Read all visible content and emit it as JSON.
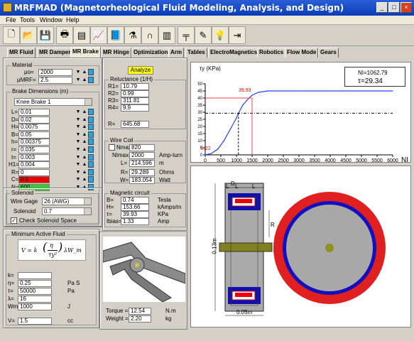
{
  "window": {
    "title": "MRFMAD (Magnetorheological Fluid Modeling, Analysis, and Design)",
    "min": "_",
    "max": "□",
    "close": "×"
  },
  "menu": [
    "File",
    "Tools",
    "Window",
    "Help"
  ],
  "toolbar_icons": [
    "new-icon",
    "open-icon",
    "save-icon",
    "print-icon",
    "database-icon",
    "chart-icon",
    "book-icon",
    "flask-icon",
    "magnet-icon",
    "cylinder-icon",
    "crane-icon",
    "edit-icon",
    "bulb-icon",
    "exit-icon"
  ],
  "tabs": [
    "MR Fluid",
    "MR Damper",
    "MR Brake",
    "MR Hinge",
    "Optimization",
    "Arm",
    "Tables",
    "ElectroMagnetics",
    "Robotics",
    "Flow Mode",
    "Gears"
  ],
  "material": {
    "title": "Material",
    "mu_label": "μo=",
    "mu": "2000",
    "murp_label": "μMRF=",
    "murp": "2.5"
  },
  "brake_dims": {
    "title": "Brake Dimensions (m)",
    "select": "Knee Brake 1",
    "rows": [
      {
        "label": "L=",
        "value": "0.01"
      },
      {
        "label": "D=",
        "value": "0.02"
      },
      {
        "label": "H=",
        "value": "0.0075"
      },
      {
        "label": "B=",
        "value": "0.05"
      },
      {
        "label": "h=",
        "value": "0.00375"
      },
      {
        "label": "r=",
        "value": "0.035"
      },
      {
        "label": "t=",
        "value": "0.003"
      },
      {
        "label": "H1=",
        "value": "0.004"
      },
      {
        "label": "R=",
        "value": "0"
      },
      {
        "label": "C=",
        "value": "0.0"
      },
      {
        "label": "N=",
        "value": "600"
      }
    ]
  },
  "reluctance": {
    "title": "Reluctance (1/H)",
    "rows": [
      {
        "label": "R1=",
        "value": "10.79"
      },
      {
        "label": "R2=",
        "value": "0.99"
      },
      {
        "label": "R3=",
        "value": "311.81"
      },
      {
        "label": "R4=",
        "value": "9.9"
      }
    ],
    "total_label": "R=",
    "total": "645.68"
  },
  "analyze": "Analyze",
  "wire_coil": {
    "title": "Wire Coil",
    "nmax_label": "Nmax=",
    "nmax": "820",
    "nimax_label": "NImax=",
    "nimax": "2000",
    "nimax_unit": "Amp-turn",
    "l_label": "L=",
    "l": "214.596",
    "l_unit": "m",
    "r_label": "R=",
    "r": "29.289",
    "r_unit": "Ohms",
    "w_label": "W=",
    "w": "183.054",
    "w_unit": "Watt"
  },
  "mag_circuit": {
    "title": "Magnetic circuit",
    "rows": [
      {
        "label": "B=",
        "value": "0.74",
        "unit": "Tesla"
      },
      {
        "label": "H=",
        "value": "153.66",
        "unit": "kAmps/m"
      },
      {
        "label": "τ=",
        "value": "39.93",
        "unit": "KPa"
      },
      {
        "label": "Ibias=",
        "value": "1.33",
        "unit": "Amp"
      }
    ]
  },
  "solenoid": {
    "title": "Solenoid",
    "wire_label": "Wire Gage",
    "wire": "26 (AWG)",
    "sol_label": "Solenoid",
    "sol": "0.7",
    "check_label": "Check Solenoid Space",
    "check": "✓"
  },
  "min_fluid": {
    "title": "Minimum Active Fluid",
    "formula_v": "V = k",
    "formula_frac_top": "η",
    "formula_frac_bot": "τy²",
    "formula_tail": "λW_m",
    "rows": [
      {
        "label": "k=",
        "value": "",
        "unit": ""
      },
      {
        "label": "η=",
        "value": "0.25",
        "unit": "Pa S"
      },
      {
        "label": "τ=",
        "value": "50000",
        "unit": "Pa"
      },
      {
        "label": "λ=",
        "value": "16",
        "unit": ""
      },
      {
        "label": "Wm=",
        "value": "1000",
        "unit": "J"
      }
    ],
    "v_label": "V=",
    "v": "1.5",
    "v_unit": "cc"
  },
  "torque": {
    "label": "Torque =",
    "value": "12.54",
    "unit": "N.m"
  },
  "weight": {
    "label": "Weight =",
    "value": "2.20",
    "unit": "kg"
  },
  "chart_labels": {
    "ylabel": "τy (KPa)",
    "xlabel": "NI",
    "ni_label": "NI=1062.79",
    "tau_label": "τ=29.34",
    "mark1": "39.93",
    "mark2": "6.22"
  },
  "drawing": {
    "dim_l1": "L",
    "dim_l2": "L",
    "dim_l3": "L",
    "dim_r": "R",
    "dim_d": "D",
    "dim_w": "0.05m",
    "dim_h": "0.13m"
  },
  "chart_data": {
    "type": "line",
    "x": [
      0,
      200,
      400,
      600,
      800,
      1000,
      1062.79,
      1200,
      1400,
      1500,
      1700,
      2000,
      3000,
      4000,
      5000,
      6000
    ],
    "y": [
      0,
      1,
      4,
      10,
      18,
      26,
      29.34,
      35,
      40,
      42,
      44,
      45,
      45,
      45,
      45,
      45
    ],
    "xlim": [
      0,
      6000
    ],
    "ylim": [
      0,
      50
    ],
    "xticks": [
      "0",
      "500",
      "1000",
      "1500",
      "2000",
      "2500",
      "3000",
      "3500",
      "4000",
      "4500",
      "5000",
      "5500",
      "6000"
    ],
    "yticks": [
      "0",
      "5",
      "10",
      "15",
      "20",
      "25",
      "30",
      "35",
      "40",
      "45",
      "50"
    ],
    "xlabel": "NI",
    "ylabel": "τy (KPa)",
    "colors": {
      "curve": "#2040ff",
      "mark": "#ff4040",
      "guide": "#000000"
    }
  }
}
